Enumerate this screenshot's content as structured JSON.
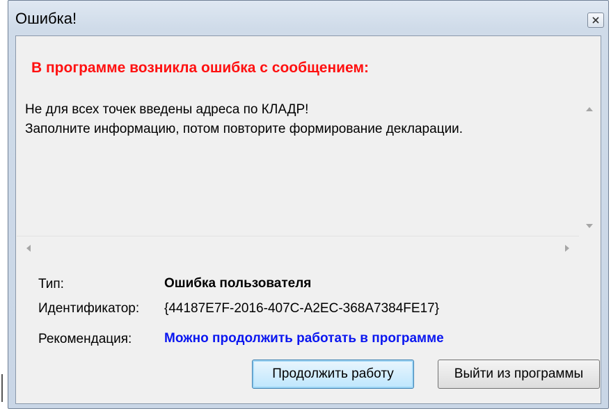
{
  "window": {
    "title": "Ошибка!",
    "close_icon": "close-icon"
  },
  "message": {
    "heading": "В программе возникла ошибка с сообщением:",
    "text": "Не для всех точек введены адреса по КЛАДР!\nЗаполните информацию, потом повторите формирование декларации."
  },
  "info": {
    "type_label": "Тип:",
    "type_value": "Ошибка пользователя",
    "id_label": "Идентификатор:",
    "id_value": "{44187E7F-2016-407C-A2EC-368A7384FE17}",
    "rec_label": "Рекомендация:",
    "rec_value": "Можно продолжить работать в программе"
  },
  "buttons": {
    "continue_label": "Продолжить работу",
    "exit_label": "Выйти из программы"
  },
  "colors": {
    "heading": "#ff1010",
    "recommendation": "#0a16f0"
  }
}
